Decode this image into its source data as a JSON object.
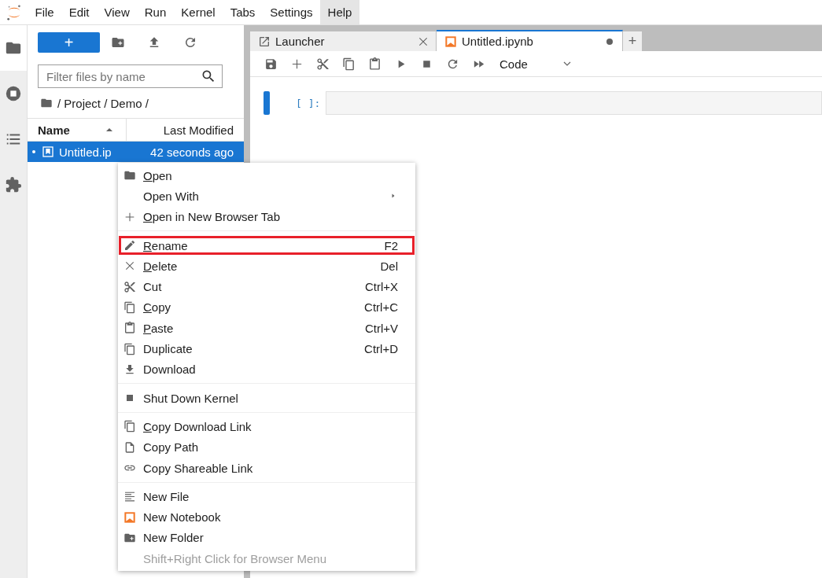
{
  "menubar": [
    {
      "label": "File",
      "selected": false
    },
    {
      "label": "Edit",
      "selected": false
    },
    {
      "label": "View",
      "selected": false
    },
    {
      "label": "Run",
      "selected": false
    },
    {
      "label": "Kernel",
      "selected": false
    },
    {
      "label": "Tabs",
      "selected": false
    },
    {
      "label": "Settings",
      "selected": false
    },
    {
      "label": "Help",
      "selected": true
    }
  ],
  "activity_bar": [
    {
      "selected": true
    },
    {
      "selected": false
    },
    {
      "selected": false
    },
    {
      "selected": false
    }
  ],
  "file_browser": {
    "new_button": "+",
    "search": {
      "placeholder": "Filter files by name"
    },
    "breadcrumb": "/ Project / Demo /",
    "columns": [
      {
        "label": "Name",
        "sorted": true
      },
      {
        "label": "Last Modified",
        "sorted": false
      }
    ],
    "rows": [
      {
        "name": "Untitled.ip",
        "modified": "42 seconds ago",
        "selected": true,
        "running": true
      }
    ]
  },
  "tabs": [
    {
      "label": "Launcher",
      "kind": "launcher",
      "selected": false,
      "dirty": false
    },
    {
      "label": "Untitled.ipynb",
      "kind": "notebook",
      "selected": true,
      "dirty": true
    }
  ],
  "add_tab": "+",
  "toolbar": {
    "cell_type": "Code"
  },
  "cells": [
    {
      "prompt": "[ ]:",
      "active": true
    }
  ],
  "context_menu": [
    {
      "kind": "item",
      "label": "Open",
      "mnemonic": true,
      "submenu": false,
      "highlighted": false,
      "disabled": false
    },
    {
      "kind": "item",
      "label": "Open With",
      "mnemonic": false,
      "submenu": true,
      "highlighted": false,
      "disabled": false
    },
    {
      "kind": "item",
      "label": "Open in New Browser Tab",
      "mnemonic": true,
      "submenu": false,
      "highlighted": false,
      "disabled": false
    },
    {
      "kind": "separator"
    },
    {
      "kind": "item",
      "label": "Rename",
      "shortcut": "F2",
      "mnemonic": true,
      "submenu": false,
      "highlighted": true,
      "disabled": false
    },
    {
      "kind": "item",
      "label": "Delete",
      "shortcut": "Del",
      "mnemonic": true,
      "submenu": false,
      "highlighted": false,
      "disabled": false
    },
    {
      "kind": "item",
      "label": "Cut",
      "shortcut": "Ctrl+X",
      "mnemonic": false,
      "submenu": false,
      "highlighted": false,
      "disabled": false
    },
    {
      "kind": "item",
      "label": "Copy",
      "shortcut": "Ctrl+C",
      "mnemonic": true,
      "submenu": false,
      "highlighted": false,
      "disabled": false
    },
    {
      "kind": "item",
      "label": "Paste",
      "shortcut": "Ctrl+V",
      "mnemonic": true,
      "submenu": false,
      "highlighted": false,
      "disabled": false
    },
    {
      "kind": "item",
      "label": "Duplicate",
      "shortcut": "Ctrl+D",
      "mnemonic": false,
      "submenu": false,
      "highlighted": false,
      "disabled": false
    },
    {
      "kind": "item",
      "label": "Download",
      "mnemonic": false,
      "submenu": false,
      "highlighted": false,
      "disabled": false
    },
    {
      "kind": "separator"
    },
    {
      "kind": "item",
      "label": "Shut Down Kernel",
      "mnemonic": false,
      "submenu": false,
      "highlighted": false,
      "disabled": false
    },
    {
      "kind": "separator"
    },
    {
      "kind": "item",
      "label": "Copy Download Link",
      "mnemonic": true,
      "submenu": false,
      "highlighted": false,
      "disabled": false
    },
    {
      "kind": "item",
      "label": "Copy Path",
      "mnemonic": false,
      "submenu": false,
      "highlighted": false,
      "disabled": false
    },
    {
      "kind": "item",
      "label": "Copy Shareable Link",
      "mnemonic": false,
      "submenu": false,
      "highlighted": false,
      "disabled": false
    },
    {
      "kind": "separator"
    },
    {
      "kind": "item",
      "label": "New File",
      "mnemonic": false,
      "submenu": false,
      "highlighted": false,
      "disabled": false
    },
    {
      "kind": "item",
      "label": "New Notebook",
      "mnemonic": false,
      "submenu": false,
      "highlighted": false,
      "disabled": false
    },
    {
      "kind": "item",
      "label": "New Folder",
      "mnemonic": false,
      "submenu": false,
      "highlighted": false,
      "disabled": false
    },
    {
      "kind": "item",
      "label": "Shift+Right Click for Browser Menu",
      "mnemonic": false,
      "submenu": false,
      "highlighted": false,
      "disabled": true
    }
  ]
}
